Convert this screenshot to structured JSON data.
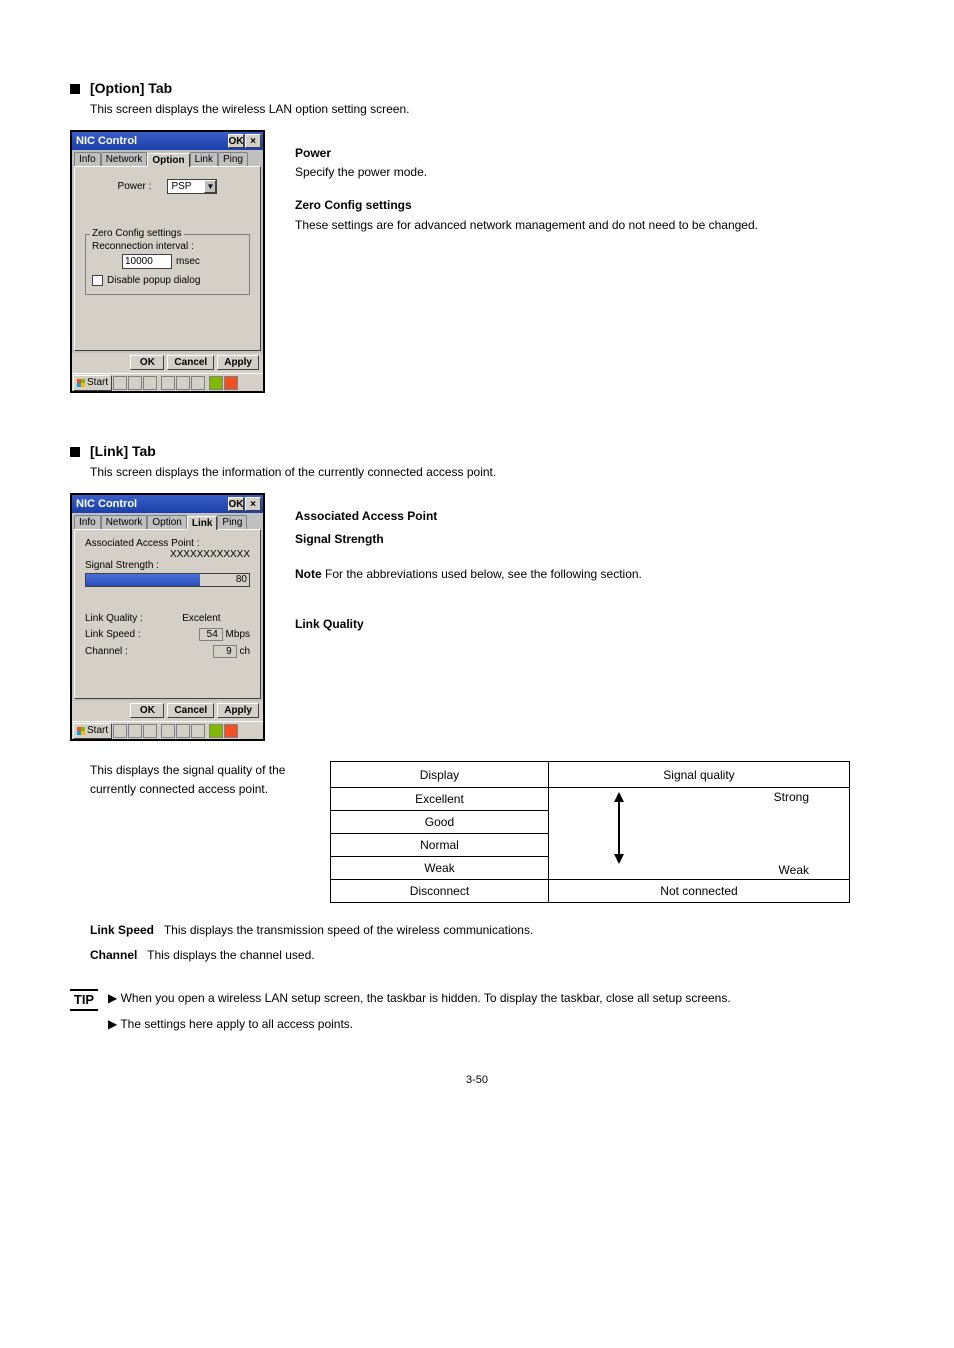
{
  "sections": {
    "option": {
      "title": "[Option] Tab",
      "desc": "This screen displays the wireless LAN option setting screen.",
      "side_items": [
        {
          "label": "Power",
          "text": "Specify the power mode."
        },
        {
          "label": "Zero Config settings",
          "text": "These settings are for advanced network management and do not need to be changed."
        }
      ]
    },
    "link": {
      "title": "[Link] Tab",
      "desc": "This screen displays the information of the currently connected access point.",
      "side_labels": {
        "ap": "Associated Access Point",
        "signal": "Signal Strength",
        "quality": "Link Quality"
      },
      "note_head": "Note",
      "note_text": "For the abbreviations used below, see the following section."
    }
  },
  "window": {
    "title": "NIC Control",
    "ok": "OK",
    "close": "×",
    "tabs": [
      "Info",
      "Network",
      "Option",
      "Link",
      "Ping"
    ],
    "option_panel": {
      "power_label": "Power :",
      "power_value": "PSP",
      "zero_legend": "Zero Config settings",
      "reconn_label": "Reconnection interval :",
      "reconn_value": "10000",
      "reconn_unit": "msec",
      "disable_popup": "Disable popup dialog"
    },
    "link_panel": {
      "ap_label": "Associated Access Point :",
      "ap_value": "XXXXXXXXXXXX",
      "signal_label": "Signal Strength :",
      "signal_value": "80",
      "quality_label": "Link Quality :",
      "quality_value": "Excelent",
      "speed_label": "Link Speed :",
      "speed_value": "54",
      "speed_unit": "Mbps",
      "channel_label": "Channel :",
      "channel_value": "9",
      "channel_unit": "ch"
    },
    "buttons": {
      "ok": "OK",
      "cancel": "Cancel",
      "apply": "Apply"
    },
    "taskbar": {
      "start": "Start"
    }
  },
  "quality_table": {
    "caption": "This displays the signal quality of the currently connected access point.",
    "header1": "Display",
    "header2": "Signal quality",
    "rows_left": [
      "Excellent",
      "Good",
      "Normal",
      "Weak",
      "Disconnect"
    ],
    "rows_right_top": "Strong",
    "rows_right_bottom": "Weak",
    "rows_right_last": "Not connected"
  },
  "final_rows": [
    {
      "label": "Link Speed",
      "text": "This displays the transmission speed of the wireless communications."
    },
    {
      "label": "Channel",
      "text": "This displays the channel used."
    }
  ],
  "tip": {
    "label": "TIP",
    "lines": [
      "▶ When you open a wireless LAN setup screen, the taskbar is hidden. To display the taskbar, close all setup screens.",
      "▶ The settings here apply to all access points."
    ]
  },
  "page_number": "3-50"
}
